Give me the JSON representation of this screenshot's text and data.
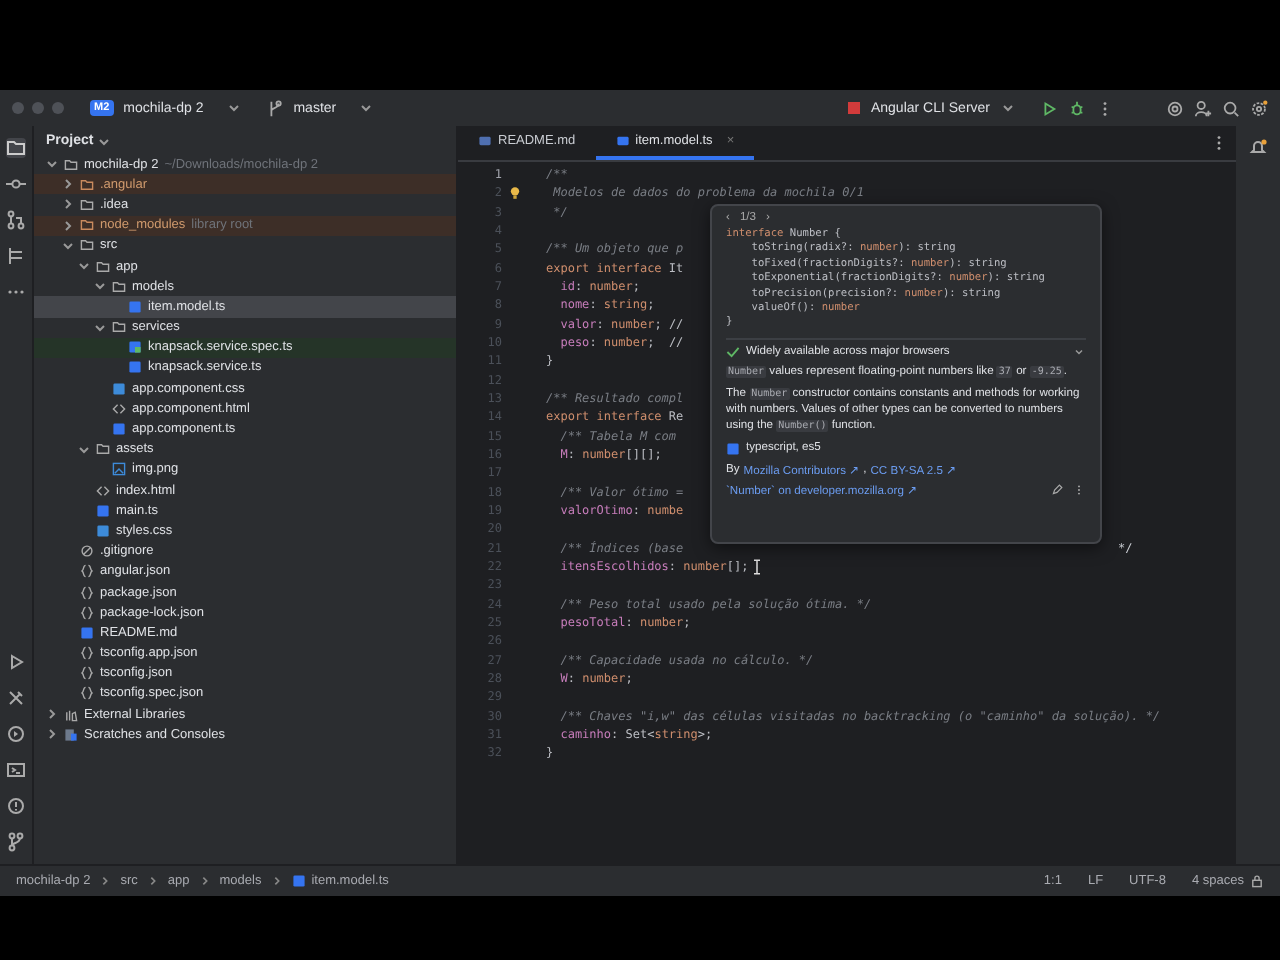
{
  "titlebar": {
    "project_badge": "M2",
    "project": "mochila-dp 2",
    "branch": "master",
    "run_config": "Angular CLI Server"
  },
  "project_panel": {
    "title": "Project",
    "tree": [
      {
        "name": "mochila-dp 2",
        "hint": "~/Downloads/mochila-dp 2",
        "kind": "folder",
        "expanded": true,
        "selected": false,
        "children": [
          {
            "name": ".angular",
            "kind": "folder",
            "expanded": false,
            "selected": false,
            "color": "#3d2e27"
          },
          {
            "name": ".idea",
            "kind": "folder",
            "expanded": false,
            "selected": false
          },
          {
            "name": "node_modules",
            "hint": "library root",
            "kind": "folder",
            "expanded": false,
            "selected": false,
            "color": "#3d2e27"
          },
          {
            "name": "src",
            "kind": "folder",
            "expanded": true,
            "selected": false,
            "children": [
              {
                "name": "app",
                "kind": "folder",
                "expanded": true,
                "selected": false,
                "children": [
                  {
                    "name": "models",
                    "kind": "folder",
                    "expanded": true,
                    "selected": false,
                    "children": [
                      {
                        "name": "item.model.ts",
                        "kind": "ts",
                        "selected": true
                      }
                    ]
                  },
                  {
                    "name": "services",
                    "kind": "folder",
                    "expanded": true,
                    "selected": false,
                    "children": [
                      {
                        "name": "knapsack.service.spec.ts",
                        "kind": "spec",
                        "selected": false,
                        "color": "#253428"
                      },
                      {
                        "name": "knapsack.service.ts",
                        "kind": "ts",
                        "selected": false
                      }
                    ]
                  },
                  {
                    "name": "app.component.css",
                    "kind": "css",
                    "selected": false
                  },
                  {
                    "name": "app.component.html",
                    "kind": "html",
                    "selected": false
                  },
                  {
                    "name": "app.component.ts",
                    "kind": "ts",
                    "selected": false
                  }
                ]
              },
              {
                "name": "assets",
                "kind": "folder",
                "expanded": true,
                "selected": false,
                "children": [
                  {
                    "name": "img.png",
                    "kind": "image",
                    "selected": false
                  }
                ]
              },
              {
                "name": "index.html",
                "kind": "html",
                "selected": false
              },
              {
                "name": "main.ts",
                "kind": "ts",
                "selected": false
              },
              {
                "name": "styles.css",
                "kind": "css",
                "selected": false
              }
            ]
          },
          {
            "name": ".gitignore",
            "kind": "ignore",
            "selected": false
          },
          {
            "name": "angular.json",
            "kind": "json",
            "selected": false
          },
          {
            "name": "package.json",
            "kind": "json",
            "selected": false
          },
          {
            "name": "package-lock.json",
            "kind": "json",
            "selected": false
          },
          {
            "name": "README.md",
            "kind": "md",
            "selected": false
          },
          {
            "name": "tsconfig.app.json",
            "kind": "json",
            "selected": false
          },
          {
            "name": "tsconfig.json",
            "kind": "json",
            "selected": false
          },
          {
            "name": "tsconfig.spec.json",
            "kind": "json",
            "selected": false
          }
        ]
      },
      {
        "name": "External Libraries",
        "kind": "library",
        "expanded": false,
        "selected": false
      },
      {
        "name": "Scratches and Consoles",
        "kind": "scratch",
        "expanded": false,
        "selected": false
      }
    ]
  },
  "tabs": [
    {
      "label": "README.md",
      "kind": "md",
      "selected": false
    },
    {
      "label": "item.model.ts",
      "kind": "ts",
      "selected": true,
      "close": "×"
    }
  ],
  "code": [
    {
      "n": "1",
      "tokens": [
        {
          "t": "/**",
          "kind": "comment"
        }
      ]
    },
    {
      "n": "2",
      "bulb": true,
      "tokens": [
        {
          "t": " Modelos de dados do problema da mochila 0/1",
          "kind": "comment"
        }
      ]
    },
    {
      "n": "3",
      "tokens": [
        {
          "t": " */",
          "kind": "comment"
        }
      ]
    },
    {
      "n": "4"
    },
    {
      "n": "5",
      "tokens": [
        {
          "t": "/** Um objeto que p",
          "kind": "comment"
        }
      ]
    },
    {
      "n": "6",
      "tokens": [
        {
          "t": "export interface ",
          "kind": "keyword"
        },
        {
          "t": "It",
          "kind": "plain"
        }
      ]
    },
    {
      "n": "7",
      "tokens": [
        {
          "t": "  id",
          "kind": "field"
        },
        {
          "t": ": ",
          "kind": "plain"
        },
        {
          "t": "number",
          "kind": "keyword"
        },
        {
          "t": ";",
          "kind": "plain"
        }
      ]
    },
    {
      "n": "8",
      "tokens": [
        {
          "t": "  nome",
          "kind": "field"
        },
        {
          "t": ": ",
          "kind": "plain"
        },
        {
          "t": "string",
          "kind": "keyword"
        },
        {
          "t": ";",
          "kind": "plain"
        }
      ]
    },
    {
      "n": "9",
      "tokens": [
        {
          "t": "  valor",
          "kind": "field"
        },
        {
          "t": ": ",
          "kind": "plain"
        },
        {
          "t": "number",
          "kind": "keyword"
        },
        {
          "t": "; //",
          "kind": "plain"
        }
      ]
    },
    {
      "n": "10",
      "tokens": [
        {
          "t": "  peso",
          "kind": "field"
        },
        {
          "t": ": ",
          "kind": "plain"
        },
        {
          "t": "number",
          "kind": "keyword"
        },
        {
          "t": ";  //",
          "kind": "plain"
        }
      ]
    },
    {
      "n": "11",
      "tokens": [
        {
          "t": "}",
          "kind": "plain"
        }
      ]
    },
    {
      "n": "12"
    },
    {
      "n": "13",
      "tokens": [
        {
          "t": "/** Resultado compl",
          "kind": "comment"
        }
      ]
    },
    {
      "n": "14",
      "tokens": [
        {
          "t": "export interface ",
          "kind": "keyword"
        },
        {
          "t": "Re",
          "kind": "plain"
        }
      ]
    },
    {
      "n": "15",
      "tokens": [
        {
          "t": "  /** Tabela M com",
          "kind": "comment"
        }
      ]
    },
    {
      "n": "16",
      "tokens": [
        {
          "t": "  M",
          "kind": "field"
        },
        {
          "t": ": ",
          "kind": "plain"
        },
        {
          "t": "number",
          "kind": "keyword"
        },
        {
          "t": "[][];",
          "kind": "plain"
        }
      ]
    },
    {
      "n": "17"
    },
    {
      "n": "18",
      "tokens": [
        {
          "t": "  /** Valor ótimo =",
          "kind": "comment"
        }
      ]
    },
    {
      "n": "19",
      "tokens": [
        {
          "t": "  valorOtimo",
          "kind": "field"
        },
        {
          "t": ": ",
          "kind": "plain"
        },
        {
          "t": "numbe",
          "kind": "keyword"
        }
      ]
    },
    {
      "n": "20"
    },
    {
      "n": "21",
      "tokens": [
        {
          "t": "  /** Índices (base",
          "kind": "comment"
        }
      ],
      "tail": "*/"
    },
    {
      "n": "22",
      "tokens": [
        {
          "t": "  itensEscolhidos",
          "kind": "field"
        },
        {
          "t": ": ",
          "kind": "plain"
        },
        {
          "t": "number",
          "kind": "keyword"
        },
        {
          "t": "[];",
          "kind": "plain"
        }
      ],
      "cursor": true
    },
    {
      "n": "23"
    },
    {
      "n": "24",
      "tokens": [
        {
          "t": "  /** Peso total usado pela solução ótima. */",
          "kind": "comment"
        }
      ]
    },
    {
      "n": "25",
      "tokens": [
        {
          "t": "  pesoTotal",
          "kind": "field"
        },
        {
          "t": ": ",
          "kind": "plain"
        },
        {
          "t": "number",
          "kind": "keyword"
        },
        {
          "t": ";",
          "kind": "plain"
        }
      ]
    },
    {
      "n": "26"
    },
    {
      "n": "27",
      "tokens": [
        {
          "t": "  /** Capacidade usada no cálculo. */",
          "kind": "comment"
        }
      ]
    },
    {
      "n": "28",
      "tokens": [
        {
          "t": "  W",
          "kind": "field"
        },
        {
          "t": ": ",
          "kind": "plain"
        },
        {
          "t": "number",
          "kind": "keyword"
        },
        {
          "t": ";",
          "kind": "plain"
        }
      ]
    },
    {
      "n": "29"
    },
    {
      "n": "30",
      "tokens": [
        {
          "t": "  /** Chaves \"i,w\" das células visitadas no backtracking (o \"caminho\" da solução). */",
          "kind": "comment"
        }
      ]
    },
    {
      "n": "31",
      "tokens": [
        {
          "t": "  caminho",
          "kind": "field"
        },
        {
          "t": ": Set<",
          "kind": "plain"
        },
        {
          "t": "string",
          "kind": "keyword"
        },
        {
          "t": ">;",
          "kind": "plain"
        }
      ]
    },
    {
      "n": "32",
      "tokens": [
        {
          "t": "}",
          "kind": "plain"
        }
      ]
    }
  ],
  "popup": {
    "prev": "‹",
    "page": "1/3",
    "next": "›",
    "signature": [
      [
        {
          "t": "interface ",
          "kind": "keyword"
        },
        {
          "t": "Number {",
          "kind": "plain"
        }
      ],
      [
        {
          "t": "    toString(radix?: ",
          "kind": "plain"
        },
        {
          "t": "number",
          "kind": "keyword"
        },
        {
          "t": "): string",
          "kind": "plain"
        }
      ],
      [
        {
          "t": "    toFixed(fractionDigits?: ",
          "kind": "plain"
        },
        {
          "t": "number",
          "kind": "keyword"
        },
        {
          "t": "): string",
          "kind": "plain"
        }
      ],
      [
        {
          "t": "    toExponential(fractionDigits?: ",
          "kind": "plain"
        },
        {
          "t": "number",
          "kind": "keyword"
        },
        {
          "t": "): string",
          "kind": "plain"
        }
      ],
      [
        {
          "t": "    toPrecision(precision?: ",
          "kind": "plain"
        },
        {
          "t": "number",
          "kind": "keyword"
        },
        {
          "t": "): string",
          "kind": "plain"
        }
      ],
      [
        {
          "t": "    valueOf(): ",
          "kind": "plain"
        },
        {
          "t": "number",
          "kind": "keyword"
        }
      ],
      [
        {
          "t": "}",
          "kind": "plain"
        }
      ]
    ],
    "availability": "Widely available across major browsers",
    "paragraphs": [
      [
        {
          "t": "Number",
          "code": true
        },
        {
          "t": " values represent floating-point numbers like ",
          "code": false
        },
        {
          "t": "37",
          "code": true
        },
        {
          "t": " or ",
          "code": false
        },
        {
          "t": "-9.25",
          "code": true
        },
        {
          "t": ".",
          "code": false
        }
      ],
      [
        {
          "t": "The ",
          "code": false
        },
        {
          "t": "Number",
          "code": true
        },
        {
          "t": " constructor contains constants and methods for working with numbers. Values of other types can be converted to numbers using the ",
          "code": false
        },
        {
          "t": "Number()",
          "code": true
        },
        {
          "t": " function.",
          "code": false
        }
      ]
    ],
    "source": "typescript, es5",
    "by": "By",
    "author_link": "Mozilla Contributors ↗",
    "sep": ",",
    "license_link": "CC BY-SA 2.5 ↗",
    "mdn_link": "`Number` on developer.mozilla.org ↗"
  },
  "breadcrumb": [
    "mochila-dp 2",
    "src",
    "app",
    "models",
    "item.model.ts"
  ],
  "status": [
    "1:1",
    "LF",
    "UTF-8",
    "4 spaces"
  ]
}
